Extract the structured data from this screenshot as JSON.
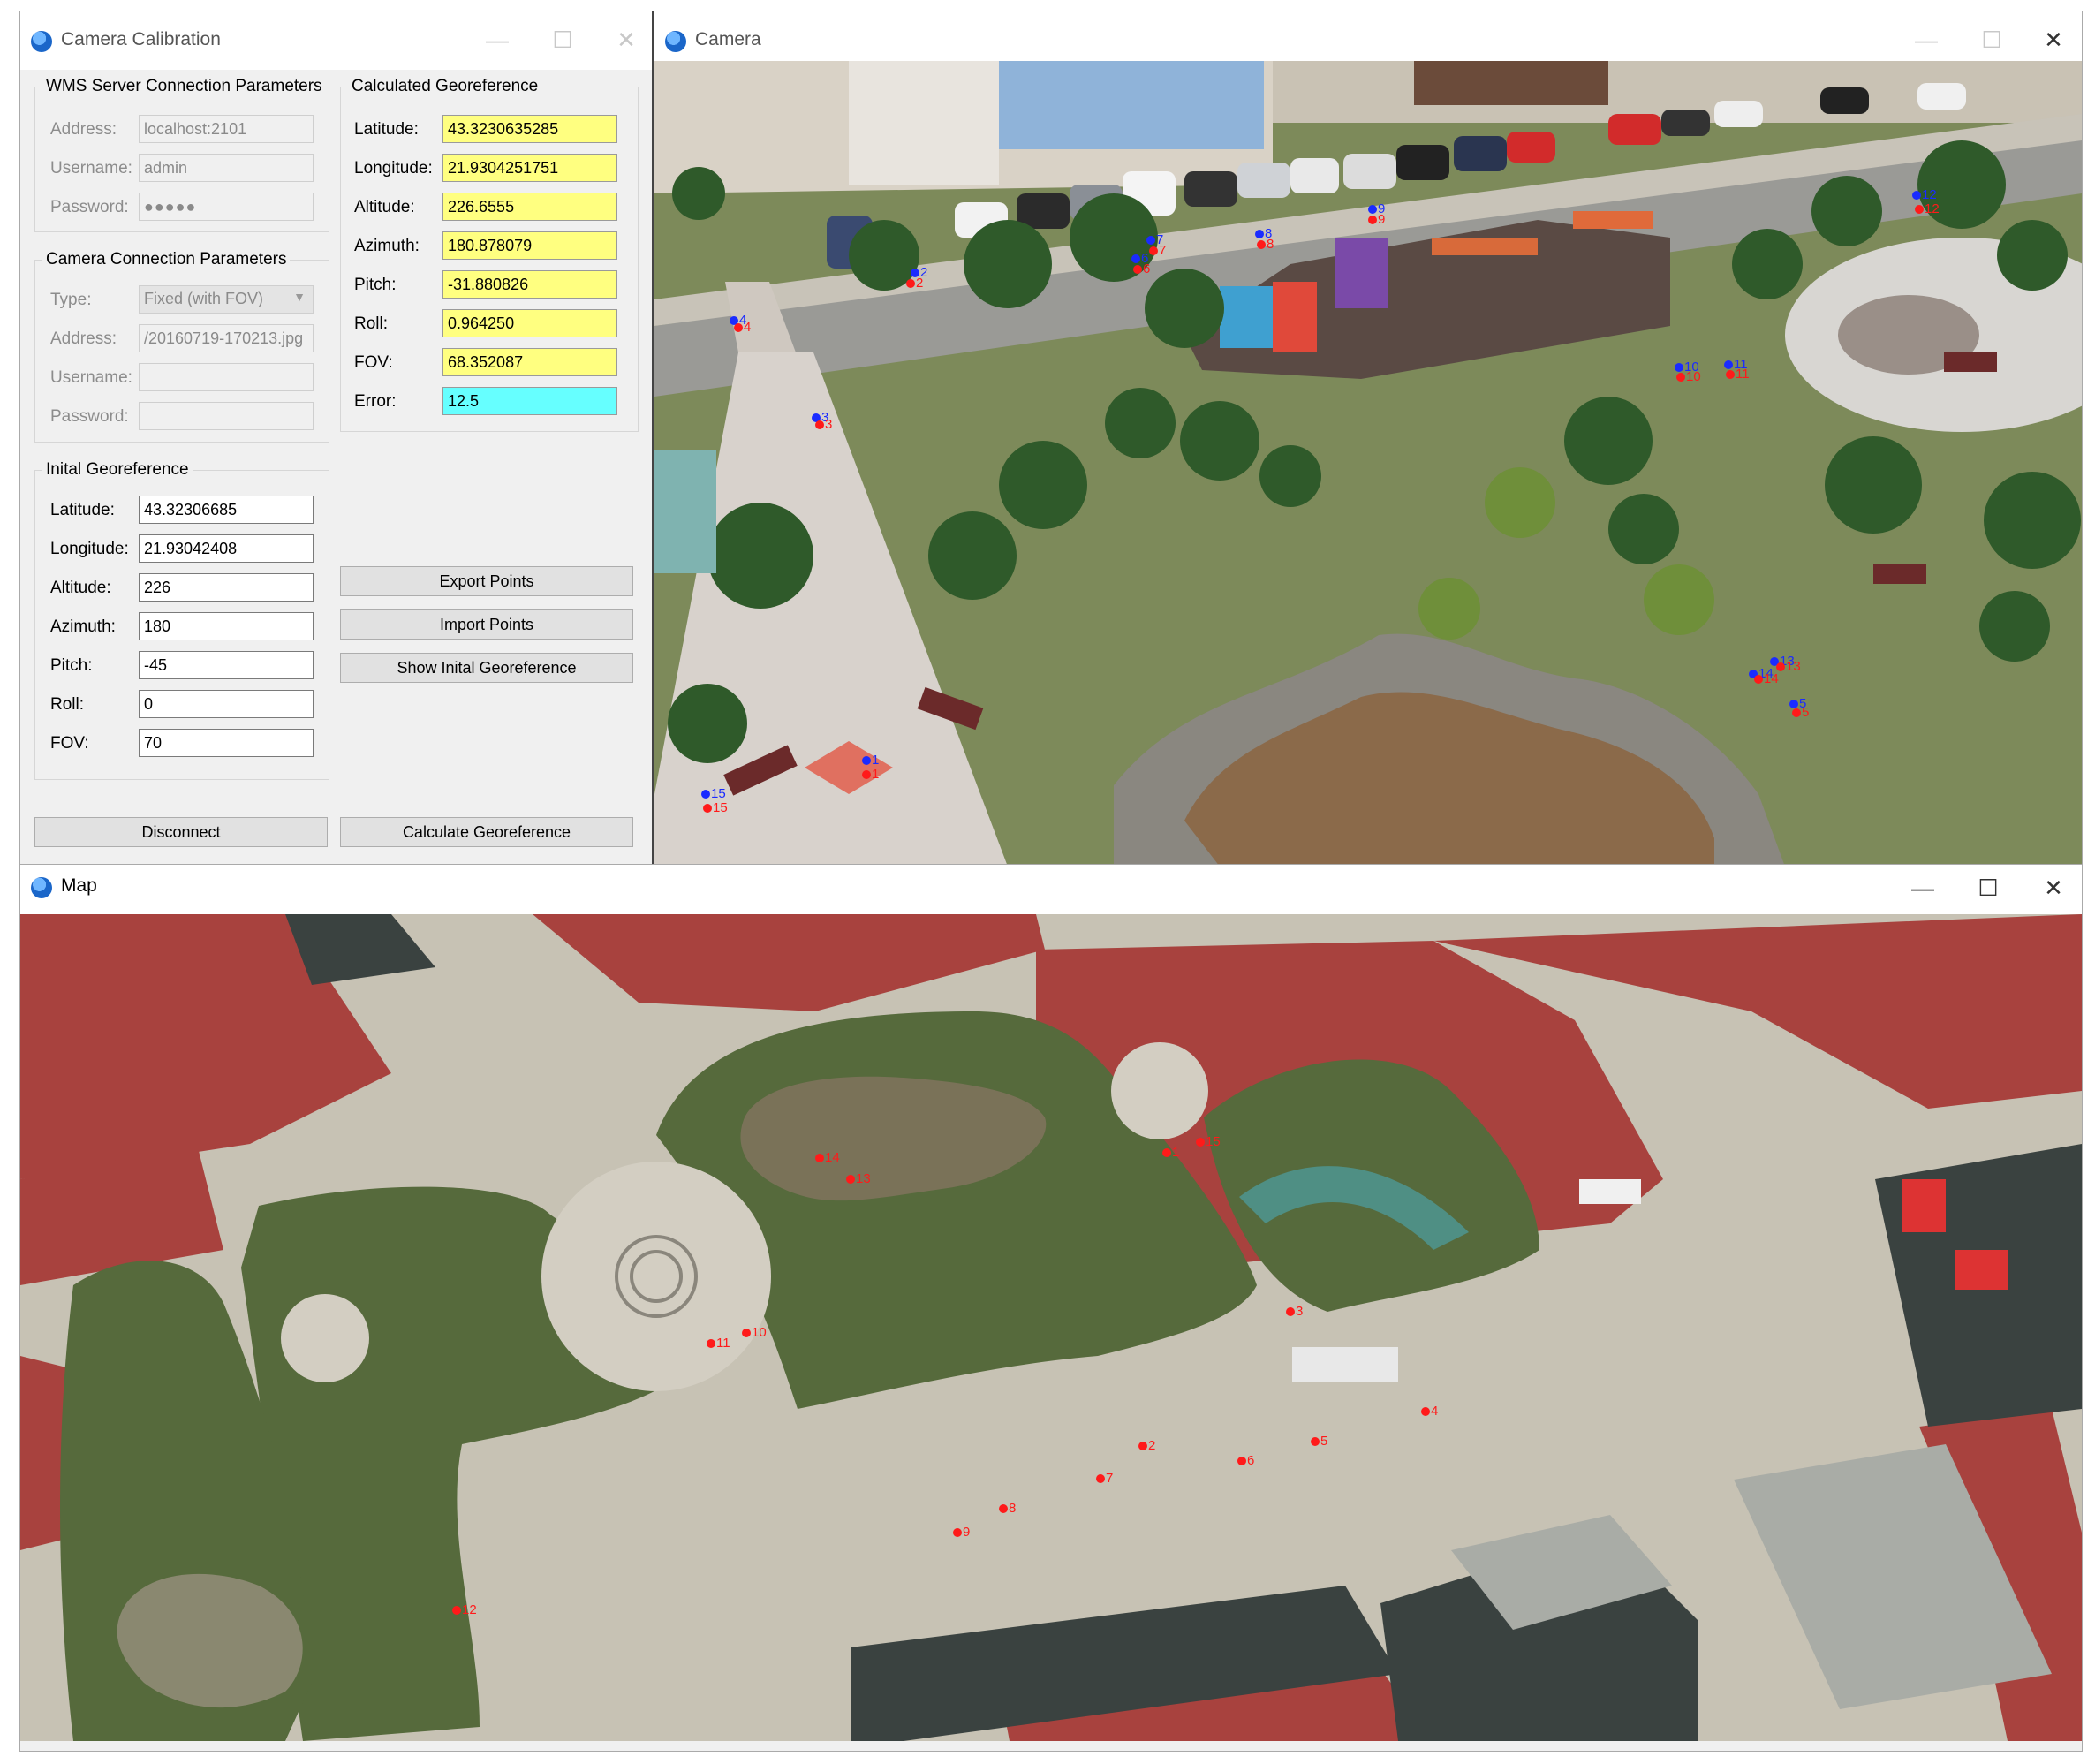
{
  "calibration_window": {
    "title": "Camera Calibration",
    "wms": {
      "legend": "WMS Server Connection Parameters",
      "address_label": "Address:",
      "address_value": "localhost:2101",
      "username_label": "Username:",
      "username_value": "admin",
      "password_label": "Password:",
      "password_value": "●●●●●"
    },
    "camera_conn": {
      "legend": "Camera Connection Parameters",
      "type_label": "Type:",
      "type_value": "Fixed (with FOV)",
      "address_label": "Address:",
      "address_value": "/20160719-170213.jpg",
      "username_label": "Username:",
      "username_value": "",
      "password_label": "Password:",
      "password_value": ""
    },
    "initial": {
      "legend": "Inital Georeference",
      "latitude_label": "Latitude:",
      "latitude_value": "43.32306685",
      "longitude_label": "Longitude:",
      "longitude_value": "21.93042408",
      "altitude_label": "Altitude:",
      "altitude_value": "226",
      "azimuth_label": "Azimuth:",
      "azimuth_value": "180",
      "pitch_label": "Pitch:",
      "pitch_value": "-45",
      "roll_label": "Roll:",
      "roll_value": "0",
      "fov_label": "FOV:",
      "fov_value": "70"
    },
    "calculated": {
      "legend": "Calculated Georeference",
      "latitude_label": "Latitude:",
      "latitude_value": "43.3230635285",
      "longitude_label": "Longitude:",
      "longitude_value": "21.9304251751",
      "altitude_label": "Altitude:",
      "altitude_value": "226.6555",
      "azimuth_label": "Azimuth:",
      "azimuth_value": "180.878079",
      "pitch_label": "Pitch:",
      "pitch_value": "-31.880826",
      "roll_label": "Roll:",
      "roll_value": "0.964250",
      "fov_label": "FOV:",
      "fov_value": "68.352087",
      "error_label": "Error:",
      "error_value": "12.5"
    },
    "buttons": {
      "export": "Export Points",
      "import": "Import Points",
      "show_initial": "Show Inital Georeference",
      "disconnect": "Disconnect",
      "calculate": "Calculate Georeference"
    }
  },
  "camera_window": {
    "title": "Camera",
    "points": [
      "1",
      "2",
      "3",
      "4",
      "5",
      "6",
      "7",
      "8",
      "9",
      "10",
      "11",
      "12",
      "13",
      "14",
      "15"
    ]
  },
  "map_window": {
    "title": "Map",
    "points": [
      "1",
      "2",
      "3",
      "4",
      "5",
      "6",
      "7",
      "8",
      "9",
      "10",
      "11",
      "12",
      "13",
      "14",
      "15"
    ]
  },
  "window_controls": {
    "minimize": "—",
    "maximize": "☐",
    "close": "✕"
  },
  "colors": {
    "marker_red": "#ff1a1a",
    "marker_blue": "#1a2bff",
    "computed_field": "#ffff80",
    "error_field": "#66ffff"
  }
}
